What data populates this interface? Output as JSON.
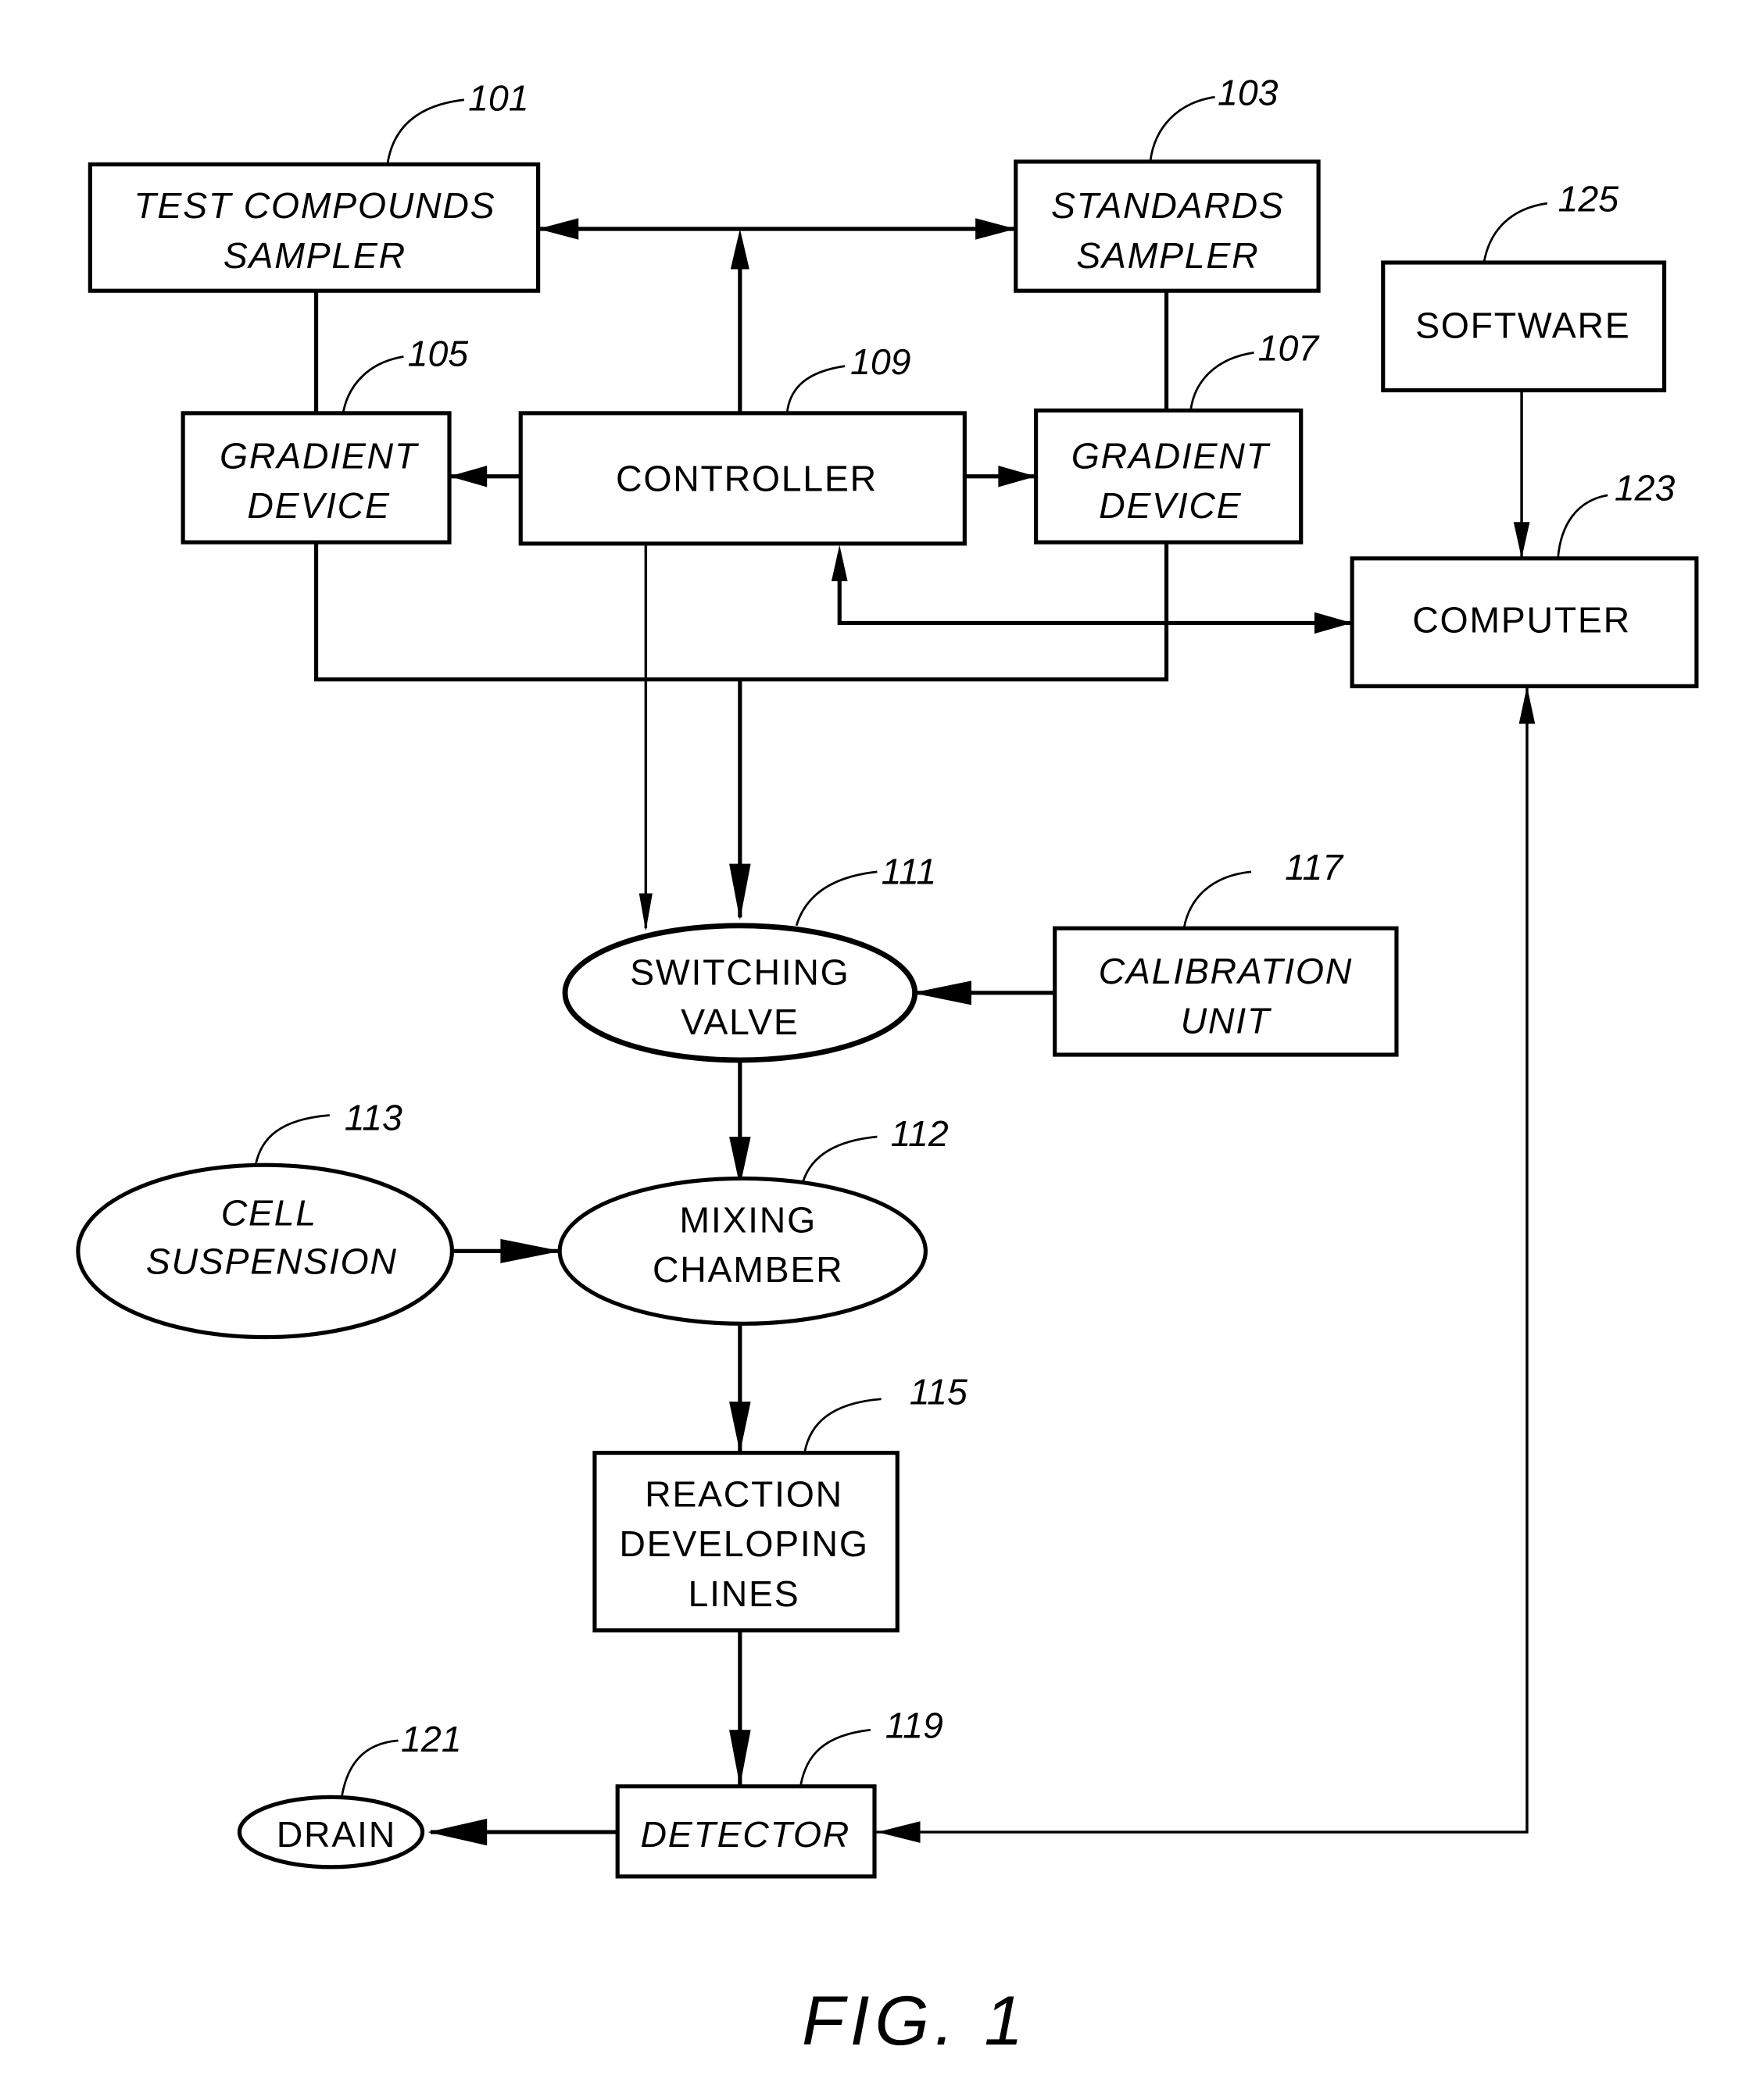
{
  "figure": {
    "caption": "FIG. 1",
    "nodes": [
      {
        "id": "test-compounds-sampler",
        "ref": "101",
        "lines": [
          "TEST COMPOUNDS",
          "SAMPLER"
        ],
        "shape": "rect",
        "italic": true
      },
      {
        "id": "standards-sampler",
        "ref": "103",
        "lines": [
          "STANDARDS",
          "SAMPLER"
        ],
        "shape": "rect",
        "italic": true
      },
      {
        "id": "software",
        "ref": "125",
        "lines": [
          "SOFTWARE"
        ],
        "shape": "rect",
        "italic": false
      },
      {
        "id": "gradient-device-left",
        "ref": "105",
        "lines": [
          "GRADIENT",
          "DEVICE"
        ],
        "shape": "rect",
        "italic": true
      },
      {
        "id": "controller",
        "ref": "109",
        "lines": [
          "CONTROLLER"
        ],
        "shape": "rect",
        "italic": false
      },
      {
        "id": "gradient-device-right",
        "ref": "107",
        "lines": [
          "GRADIENT",
          "DEVICE"
        ],
        "shape": "rect",
        "italic": true
      },
      {
        "id": "computer",
        "ref": "123",
        "lines": [
          "COMPUTER"
        ],
        "shape": "rect",
        "italic": false
      },
      {
        "id": "switching-valve",
        "ref": "111",
        "lines": [
          "SWITCHING",
          "VALVE"
        ],
        "shape": "ellipse",
        "italic": false
      },
      {
        "id": "calibration-unit",
        "ref": "117",
        "lines": [
          "CALIBRATION",
          "UNIT"
        ],
        "shape": "rect",
        "italic": true
      },
      {
        "id": "cell-suspension",
        "ref": "113",
        "lines": [
          "CELL",
          "SUSPENSION"
        ],
        "shape": "ellipse",
        "italic": true
      },
      {
        "id": "mixing-chamber",
        "ref": "112",
        "lines": [
          "MIXING",
          "CHAMBER"
        ],
        "shape": "ellipse",
        "italic": false
      },
      {
        "id": "reaction-developing-lines",
        "ref": "115",
        "lines": [
          "REACTION",
          "DEVELOPING",
          "LINES"
        ],
        "shape": "rect",
        "italic": false
      },
      {
        "id": "detector",
        "ref": "119",
        "lines": [
          "DETECTOR"
        ],
        "shape": "rect",
        "italic": true
      },
      {
        "id": "drain",
        "ref": "121",
        "lines": [
          "DRAIN"
        ],
        "shape": "ellipse",
        "italic": false
      }
    ],
    "connections": [
      {
        "from": "controller",
        "to": "test-compounds-sampler"
      },
      {
        "from": "controller",
        "to": "standards-sampler"
      },
      {
        "from": "controller",
        "to": "gradient-device-left"
      },
      {
        "from": "controller",
        "to": "gradient-device-right"
      },
      {
        "from": "test-compounds-sampler",
        "to": "gradient-device-left",
        "directed": false
      },
      {
        "from": "standards-sampler",
        "to": "gradient-device-right",
        "directed": false
      },
      {
        "from": "software",
        "to": "computer"
      },
      {
        "from": "computer",
        "to": "controller"
      },
      {
        "from": "controller",
        "to": "computer"
      },
      {
        "from": "gradient-device-left",
        "to": "switching-valve"
      },
      {
        "from": "gradient-device-right",
        "to": "switching-valve"
      },
      {
        "from": "controller",
        "to": "switching-valve"
      },
      {
        "from": "calibration-unit",
        "to": "switching-valve"
      },
      {
        "from": "switching-valve",
        "to": "mixing-chamber"
      },
      {
        "from": "cell-suspension",
        "to": "mixing-chamber"
      },
      {
        "from": "mixing-chamber",
        "to": "reaction-developing-lines"
      },
      {
        "from": "reaction-developing-lines",
        "to": "detector"
      },
      {
        "from": "detector",
        "to": "drain"
      },
      {
        "from": "detector",
        "to": "computer"
      }
    ]
  }
}
